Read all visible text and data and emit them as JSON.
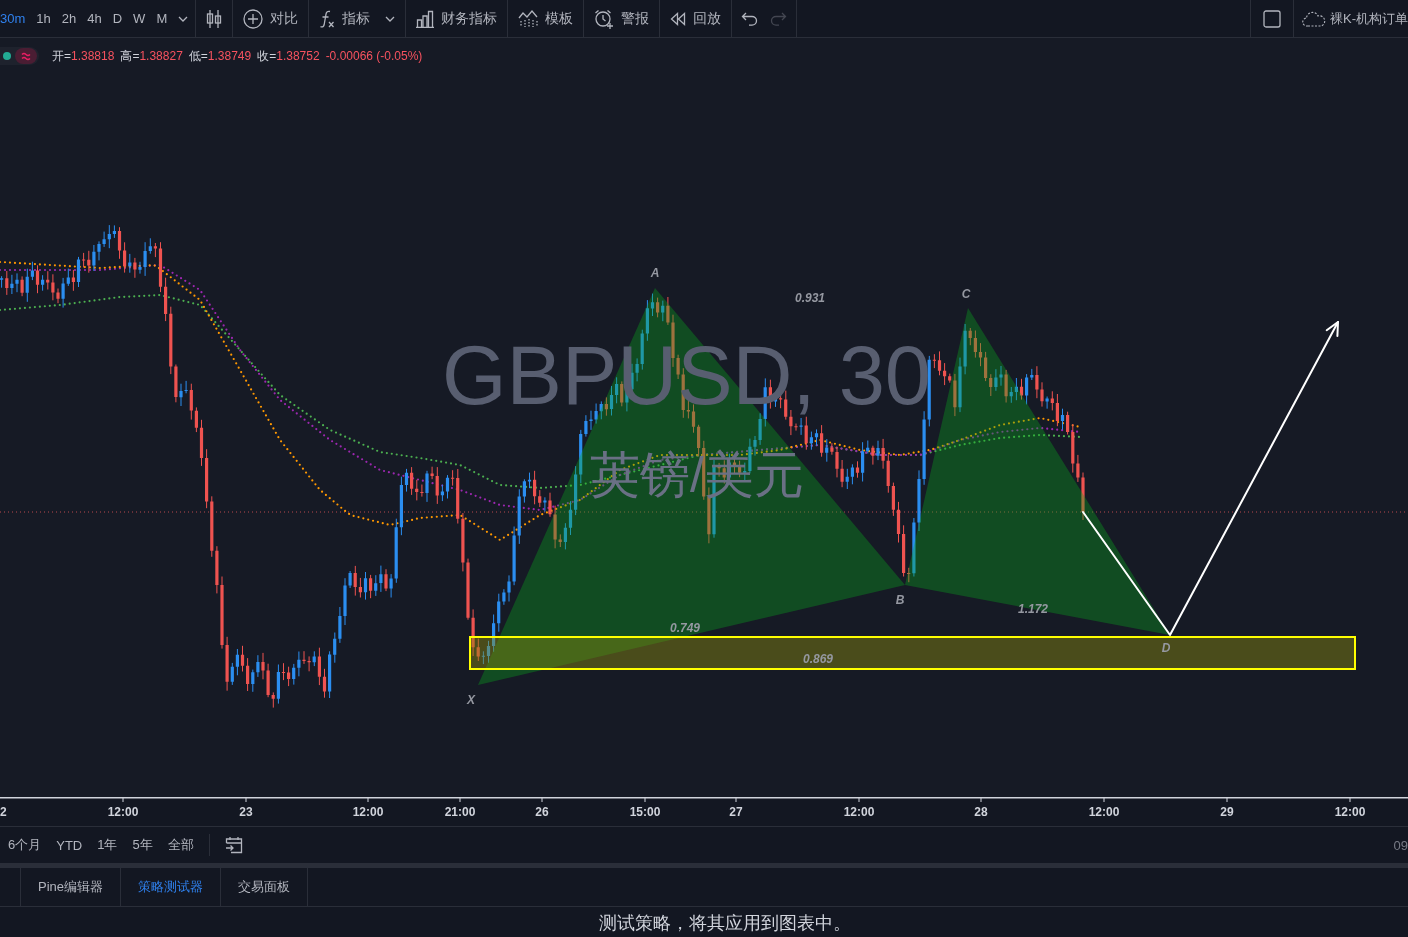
{
  "toolbar": {
    "intervals": [
      {
        "label": "30m",
        "selected": true
      },
      {
        "label": "1h",
        "selected": false
      },
      {
        "label": "2h",
        "selected": false
      },
      {
        "label": "4h",
        "selected": false
      },
      {
        "label": "D",
        "selected": false
      },
      {
        "label": "W",
        "selected": false
      },
      {
        "label": "M",
        "selected": false
      }
    ],
    "buttons": [
      {
        "kind": "compare",
        "label": "对比",
        "dropdown": false
      },
      {
        "kind": "indicators",
        "label": "指标",
        "dropdown": true
      },
      {
        "kind": "financials",
        "label": "财务指标",
        "dropdown": false
      },
      {
        "kind": "templates",
        "label": "模板",
        "dropdown": false
      },
      {
        "kind": "alert",
        "label": "警报",
        "dropdown": false
      },
      {
        "kind": "replay",
        "label": "回放",
        "dropdown": false
      }
    ],
    "history": [
      {
        "kind": "undo",
        "disabled": false
      },
      {
        "kind": "redo",
        "disabled": true
      }
    ],
    "layout_button": {
      "label": "裸K-机构订单"
    }
  },
  "legend": {
    "market_open": true,
    "values": [
      {
        "label": "开=",
        "value": "1.38818"
      },
      {
        "label": "高=",
        "value": "1.38827"
      },
      {
        "label": "低=",
        "value": "1.38749"
      },
      {
        "label": "收=",
        "value": "1.38752"
      }
    ],
    "change": "-0.00066 (-0.05%)"
  },
  "chart": {
    "watermark": {
      "symbol": "GBPUSD, 30",
      "description": "英镑/美元"
    },
    "pattern": {
      "points": [
        "X",
        "A",
        "B",
        "C",
        "D"
      ],
      "ratios": [
        "0.931",
        "0.749",
        "0.869",
        "1.172"
      ]
    },
    "time_axis": [
      "2",
      "12:00",
      "23",
      "12:00",
      "21:00",
      "26",
      "15:00",
      "27",
      "12:00",
      "28",
      "12:00",
      "29",
      "12:00"
    ]
  },
  "range_bar": {
    "ranges": [
      "6个月",
      "YTD",
      "1年",
      "5年",
      "全部"
    ],
    "time": "09"
  },
  "bottom_panel": {
    "tabs": [
      {
        "label": "Pine编辑器",
        "selected": false
      },
      {
        "label": "策略测试器",
        "selected": true
      },
      {
        "label": "交易面板",
        "selected": false
      }
    ],
    "message": "测试策略，将其应用到图表中。"
  }
}
